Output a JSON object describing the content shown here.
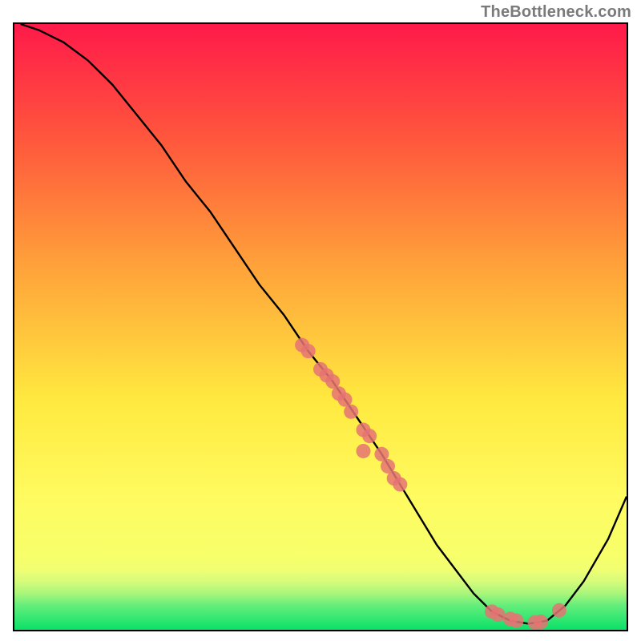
{
  "watermark": {
    "text": "TheBottleneck.com"
  },
  "chart_data": {
    "type": "line",
    "title": "",
    "xlabel": "",
    "ylabel": "",
    "xlim": [
      0,
      100
    ],
    "ylim": [
      0,
      100
    ],
    "grid": false,
    "legend": false,
    "background_gradient": {
      "direction": "vertical",
      "stops": [
        {
          "pos": 0.0,
          "color": "#ff1a4a"
        },
        {
          "pos": 0.2,
          "color": "#ff5a3c"
        },
        {
          "pos": 0.4,
          "color": "#ffa23a"
        },
        {
          "pos": 0.62,
          "color": "#ffe93f"
        },
        {
          "pos": 0.78,
          "color": "#fffb60"
        },
        {
          "pos": 0.9,
          "color": "#eaff7a"
        },
        {
          "pos": 0.95,
          "color": "#9ff08e"
        },
        {
          "pos": 1.0,
          "color": "#0ae169"
        }
      ]
    },
    "series": [
      {
        "name": "bottleneck-curve",
        "color": "#000000",
        "type": "line",
        "x": [
          1,
          4,
          8,
          12,
          16,
          20,
          24,
          28,
          32,
          36,
          40,
          44,
          48,
          52,
          56,
          60,
          63,
          66,
          69,
          72,
          75,
          78,
          81,
          84,
          87,
          90,
          93,
          97,
          100
        ],
        "y": [
          100,
          99,
          97,
          94,
          90,
          85,
          80,
          74,
          69,
          63,
          57,
          52,
          46,
          41,
          35,
          29,
          24,
          19,
          14,
          10,
          6,
          3,
          1.5,
          1,
          1.5,
          4,
          8,
          15,
          22
        ]
      }
    ],
    "scatter_points": {
      "name": "highlighted-points",
      "color": "#e57373",
      "points": [
        {
          "x": 47,
          "y": 47
        },
        {
          "x": 48,
          "y": 46
        },
        {
          "x": 50,
          "y": 43
        },
        {
          "x": 51,
          "y": 42
        },
        {
          "x": 52,
          "y": 41
        },
        {
          "x": 53,
          "y": 39
        },
        {
          "x": 54,
          "y": 38
        },
        {
          "x": 55,
          "y": 36
        },
        {
          "x": 57,
          "y": 33
        },
        {
          "x": 58,
          "y": 32
        },
        {
          "x": 60,
          "y": 29
        },
        {
          "x": 61,
          "y": 27
        },
        {
          "x": 62,
          "y": 25
        },
        {
          "x": 63,
          "y": 24
        },
        {
          "x": 78,
          "y": 3.0
        },
        {
          "x": 79,
          "y": 2.5
        },
        {
          "x": 81,
          "y": 1.8
        },
        {
          "x": 82,
          "y": 1.5
        },
        {
          "x": 85,
          "y": 1.2
        },
        {
          "x": 86,
          "y": 1.3
        },
        {
          "x": 89,
          "y": 3.2
        },
        {
          "x": 57,
          "y": 29.5
        }
      ]
    }
  }
}
